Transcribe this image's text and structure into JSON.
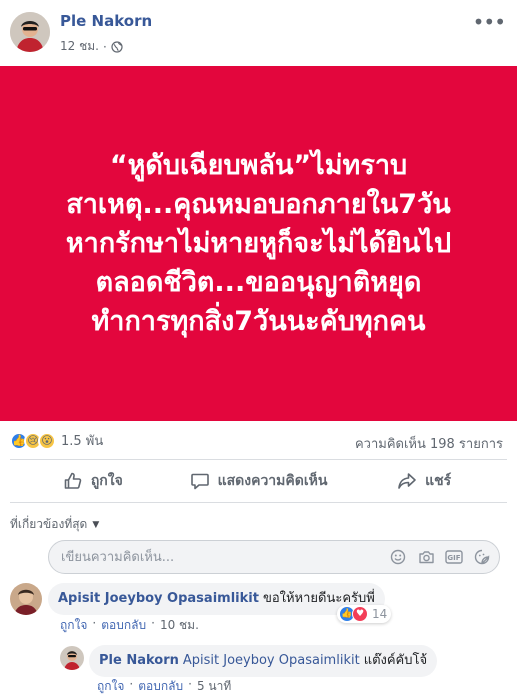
{
  "post": {
    "author": "Ple Nakorn",
    "time": "12 ชม.",
    "privacy_icon": "globe-icon",
    "banner_color": "#e3063d",
    "banner_lines": [
      "“หูดับเฉียบพลัน”ไม่ทราบ",
      "สาเหตุ...คุณหมอบอกภายใน7วัน",
      "หากรักษาไม่หายหูก็จะไม่ได้ยินไป",
      "ตลอดชีวิต...ขออนุญาติหยุด",
      "ทำการทุกสิ่ง7วันนะคับทุกคน"
    ]
  },
  "stats": {
    "reaction_icons": [
      "like-icon",
      "sad-icon",
      "wow-icon"
    ],
    "reaction_count": "1.5 พัน",
    "comment_count": "ความคิดเห็น 198 รายการ"
  },
  "actions": {
    "like": "ถูกใจ",
    "comment": "แสดงความคิดเห็น",
    "share": "แชร์"
  },
  "filter": {
    "label": "ที่เกี่ยวข้องที่สุด"
  },
  "composer": {
    "placeholder": "เขียนความคิดเห็น...",
    "icons": [
      "emoji-icon",
      "camera-icon",
      "gif-icon",
      "sticker-icon"
    ]
  },
  "comments": [
    {
      "name": "Apisit Joeyboy Opasaimlikit",
      "text": "ขอให้หายดีนะครับพี่",
      "like": "ถูกใจ",
      "reply": "ตอบกลับ",
      "time": "10 ชม.",
      "reaction_count": "14",
      "reaction_icons": [
        "like-icon",
        "love-icon"
      ]
    },
    {
      "name": "Ple Nakorn",
      "mention": "Apisit Joeyboy Opasaimlikit",
      "text": "แต๊งค์คับโจ้",
      "like": "ถูกใจ",
      "reply": "ตอบกลับ",
      "time": "5 นาที"
    }
  ]
}
